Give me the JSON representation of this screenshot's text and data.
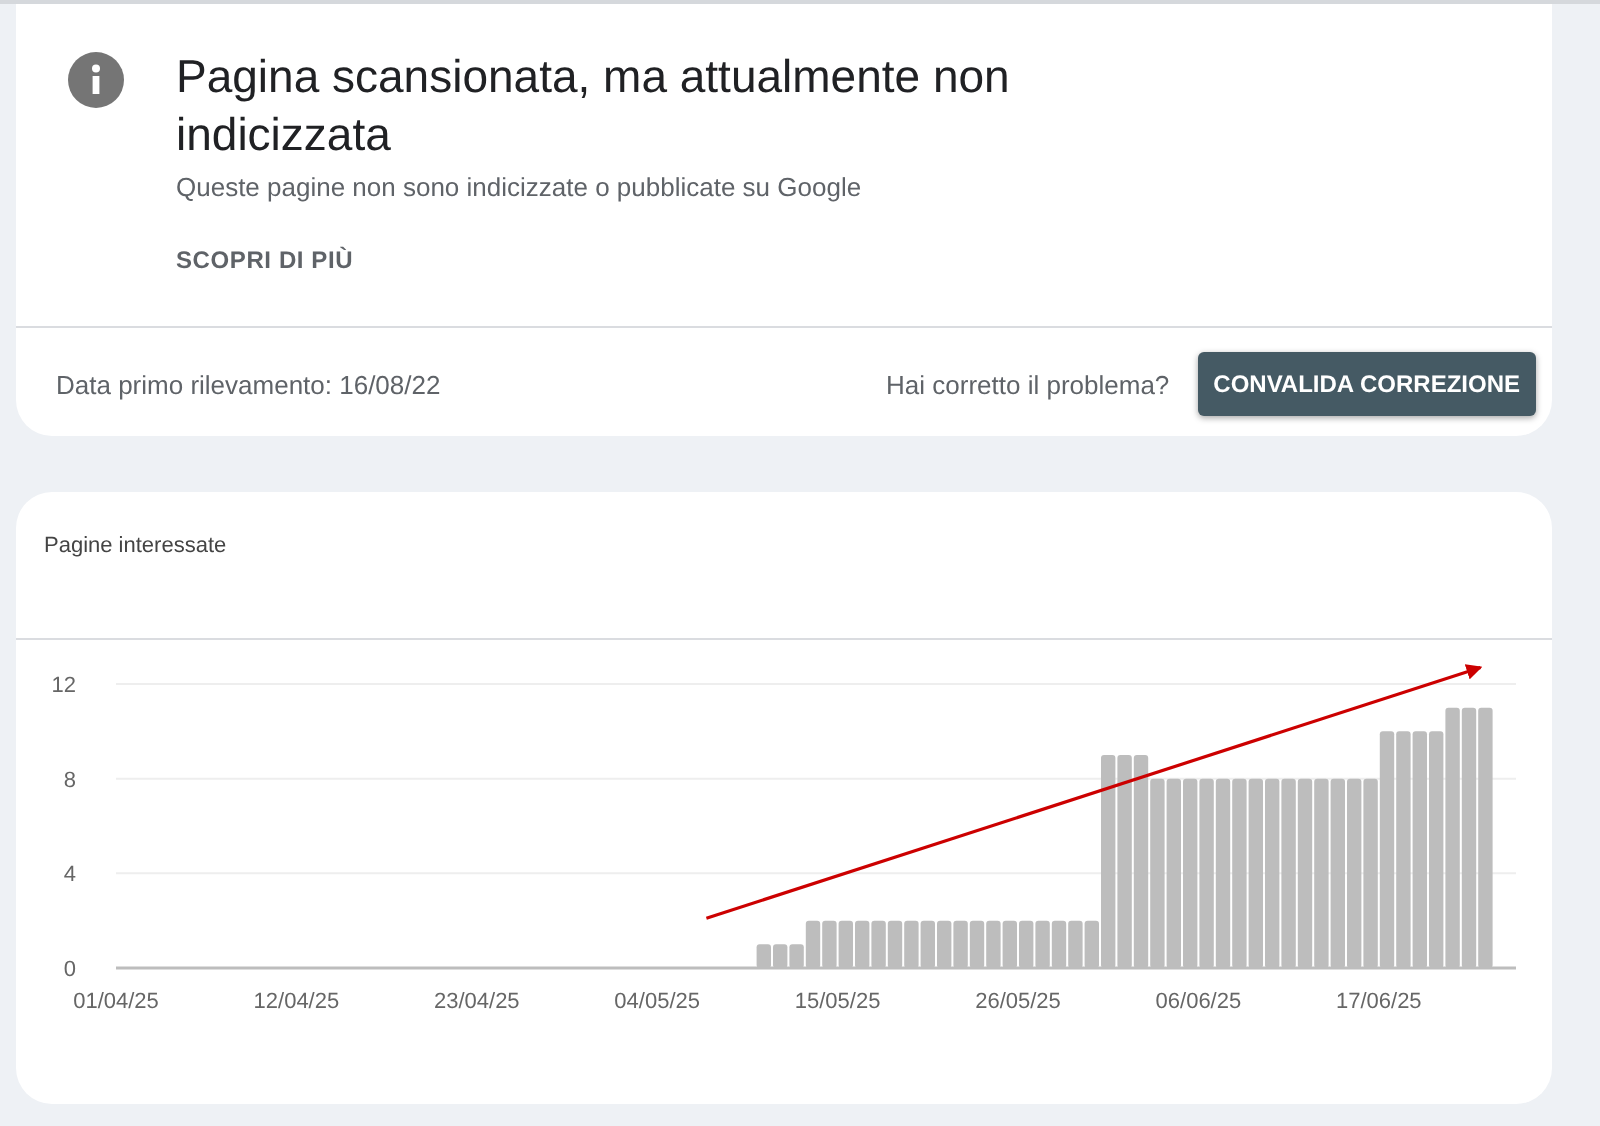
{
  "issue": {
    "title": "Pagina scansionata, ma attualmente non indicizzata",
    "subtitle": "Queste pagine non sono indicizzate o pubblicate su Google",
    "learn_more": "SCOPRI DI PIÙ",
    "first_detected": "Data primo rilevamento: 16/08/22",
    "fixed_question": "Hai corretto il problema?",
    "validate_button": "CONVALIDA CORREZIONE"
  },
  "chart_panel": {
    "title": "Pagine interessate",
    "chart_data": {
      "type": "bar",
      "categories": [
        "01/04/25",
        null,
        null,
        null,
        null,
        null,
        null,
        null,
        null,
        null,
        null,
        "12/04/25",
        null,
        null,
        null,
        null,
        null,
        null,
        null,
        null,
        null,
        null,
        "23/04/25",
        null,
        null,
        null,
        null,
        null,
        null,
        null,
        null,
        null,
        null,
        "04/05/25",
        null,
        null,
        null,
        null,
        null,
        null,
        null,
        null,
        null,
        null,
        "15/05/25",
        null,
        null,
        null,
        null,
        null,
        null,
        null,
        null,
        null,
        null,
        "26/05/25",
        null,
        null,
        null,
        null,
        null,
        null,
        null,
        null,
        null,
        null,
        "06/06/25",
        null,
        null,
        null,
        null,
        null,
        null,
        null,
        null,
        null,
        null,
        "17/06/25",
        null,
        null,
        null,
        null,
        null,
        null
      ],
      "series": [
        {
          "color": "#bdbdbd",
          "values": [
            0,
            0,
            0,
            0,
            0,
            0,
            0,
            0,
            0,
            0,
            0,
            0,
            0,
            0,
            0,
            0,
            0,
            0,
            0,
            0,
            0,
            0,
            0,
            0,
            0,
            0,
            0,
            0,
            0,
            0,
            0,
            0,
            0,
            0,
            0,
            0,
            0,
            0,
            0,
            1,
            1,
            1,
            2,
            2,
            2,
            2,
            2,
            2,
            2,
            2,
            2,
            2,
            2,
            2,
            2,
            2,
            2,
            2,
            2,
            2,
            9,
            9,
            9,
            8,
            8,
            8,
            8,
            8,
            8,
            8,
            8,
            8,
            8,
            8,
            8,
            8,
            8,
            10,
            10,
            10,
            10,
            11,
            11,
            11
          ]
        }
      ],
      "ylim": [
        0,
        12
      ],
      "yticks": [
        0,
        4,
        8,
        12
      ]
    },
    "trend_arrow": {
      "color": "#cc0000"
    }
  }
}
